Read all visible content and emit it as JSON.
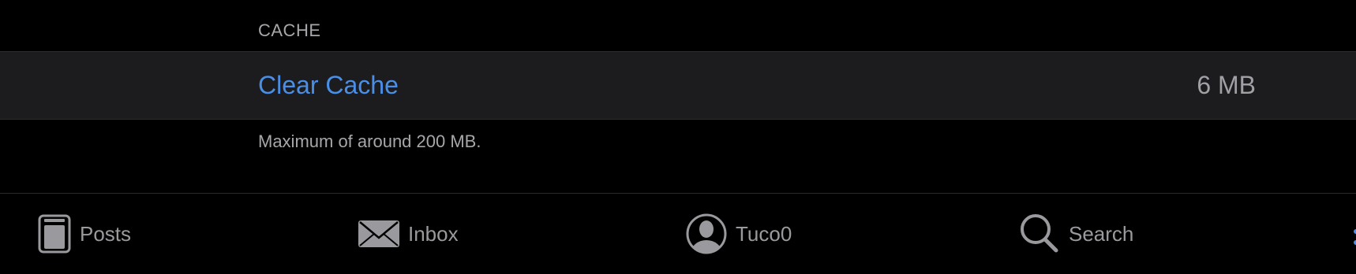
{
  "cache_section": {
    "header": "CACHE",
    "clear_cache_label": "Clear Cache",
    "cache_size": "6 MB",
    "footer": "Maximum of around 200 MB."
  },
  "tab_bar": {
    "tabs": [
      {
        "label": "Posts",
        "icon": "posts-icon"
      },
      {
        "label": "Inbox",
        "icon": "envelope-icon"
      },
      {
        "label": "Tuco0",
        "icon": "account-icon"
      },
      {
        "label": "Search",
        "icon": "search-icon"
      }
    ]
  },
  "colors": {
    "background": "#000000",
    "cell_background": "#1c1c1e",
    "accent": "#4a8fe7",
    "secondary_text": "#a7a7ab",
    "tab_inactive": "#9a9a9e"
  }
}
